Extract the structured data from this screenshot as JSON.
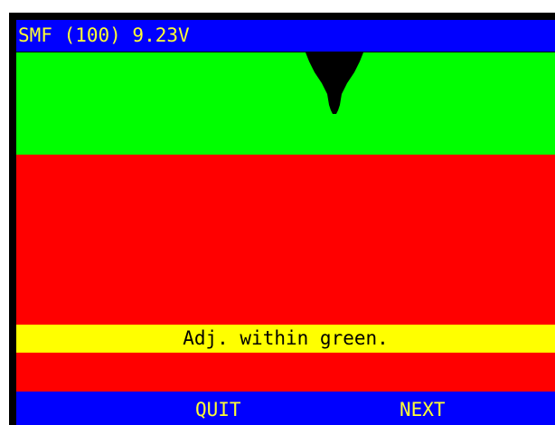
{
  "header": {
    "status_text": "SMF (100) 9.23V"
  },
  "meter": {
    "zones": [
      "green",
      "red"
    ],
    "colors": {
      "green_zone": "#00ff00",
      "red_zone": "#ff0000",
      "needle": "#000000"
    },
    "needle_icon": "needle-pointer-icon"
  },
  "message": {
    "text": "Adj. within green."
  },
  "footer": {
    "quit_label": "QUIT",
    "next_label": "NEXT"
  }
}
